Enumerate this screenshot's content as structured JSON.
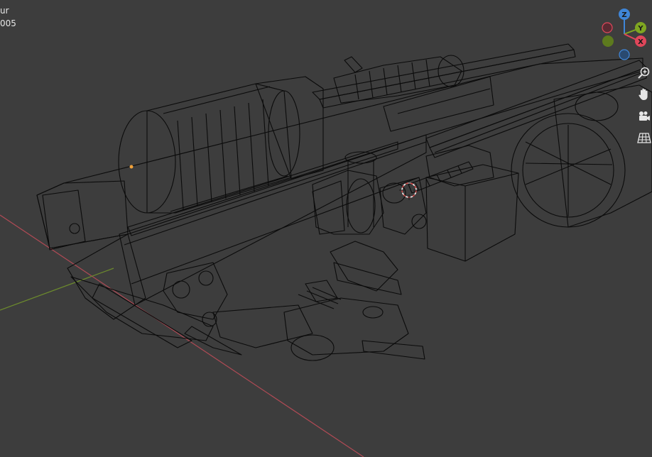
{
  "viewport": {
    "overlay_line1": "ur",
    "overlay_line2": "005"
  },
  "gizmo": {
    "z_label": "Z",
    "y_label": "Y",
    "x_label": "X",
    "colors": {
      "x": "#e0465a",
      "y": "#7fa621",
      "z": "#3f86d8"
    }
  },
  "navigation": {
    "icons": [
      "zoom-icon",
      "pan-hand-icon",
      "camera-icon",
      "perspective-grid-icon"
    ]
  },
  "colors": {
    "background": "#3d3d3d",
    "wire": "#0b0b0b",
    "x_axis_line": "#b04a55",
    "y_axis_line": "#6c8a2d",
    "origin_dot": "#f2a23a",
    "cursor": "#d84a4a"
  }
}
